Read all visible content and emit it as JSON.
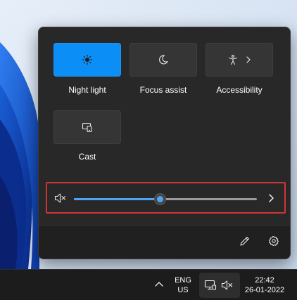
{
  "quick_settings": {
    "tiles": [
      {
        "label": "Night light",
        "active": true,
        "icon": "brightness-icon"
      },
      {
        "label": "Focus assist",
        "active": false,
        "icon": "moon-icon"
      },
      {
        "label": "Accessibility",
        "active": false,
        "icon": "accessibility-icon"
      },
      {
        "label": "Cast",
        "active": false,
        "icon": "cast-icon"
      }
    ],
    "volume": {
      "level_percent": 47,
      "muted": true,
      "icon": "speaker-muted-icon"
    },
    "footer": {
      "edit_icon": "pencil-icon",
      "settings_icon": "gear-icon"
    }
  },
  "taskbar": {
    "language": {
      "line1": "ENG",
      "line2": "US"
    },
    "clock": {
      "time": "22:42",
      "date": "26-01-2022"
    }
  },
  "colors": {
    "accent": "#0c8ef7",
    "panel": "#282828",
    "highlight_box": "#d03434"
  }
}
